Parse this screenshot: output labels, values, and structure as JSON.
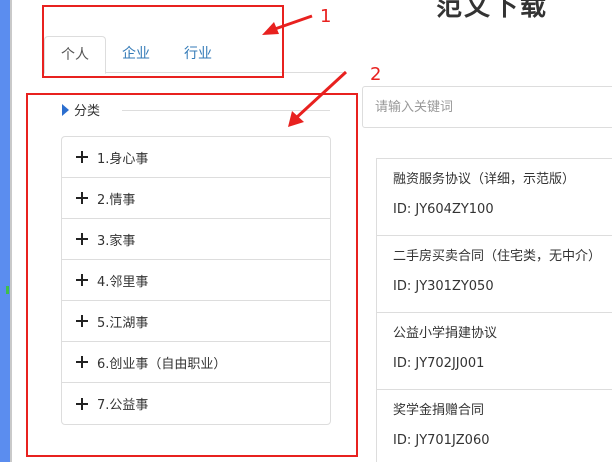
{
  "page": {
    "title": "范文下载"
  },
  "tabs": [
    {
      "label": "个人",
      "active": true
    },
    {
      "label": "企业",
      "active": false
    },
    {
      "label": "行业",
      "active": false
    }
  ],
  "category": {
    "header": "分类",
    "items": [
      {
        "label": "1.身心事"
      },
      {
        "label": "2.情事"
      },
      {
        "label": "3.家事"
      },
      {
        "label": "4.邻里事"
      },
      {
        "label": "5.江湖事"
      },
      {
        "label": "6.创业事（自由职业）"
      },
      {
        "label": "7.公益事"
      }
    ]
  },
  "search": {
    "placeholder": "请输入关键词",
    "value": ""
  },
  "documents": [
    {
      "title": "融资服务协议（详细，示范版）",
      "id": "ID: JY604ZY100"
    },
    {
      "title": "二手房买卖合同（住宅类，无中介）",
      "id": "ID: JY301ZY050"
    },
    {
      "title": "公益小学捐建协议",
      "id": "ID: JY702JJ001"
    },
    {
      "title": "奖学金捐赠合同",
      "id": "ID: JY701JZ060"
    }
  ],
  "annotations": {
    "label_1": "1",
    "label_2": "2",
    "color": "#e8211f"
  },
  "colors": {
    "accent": "#5b8def",
    "link": "#337ab7",
    "annotation": "#e8211f"
  }
}
